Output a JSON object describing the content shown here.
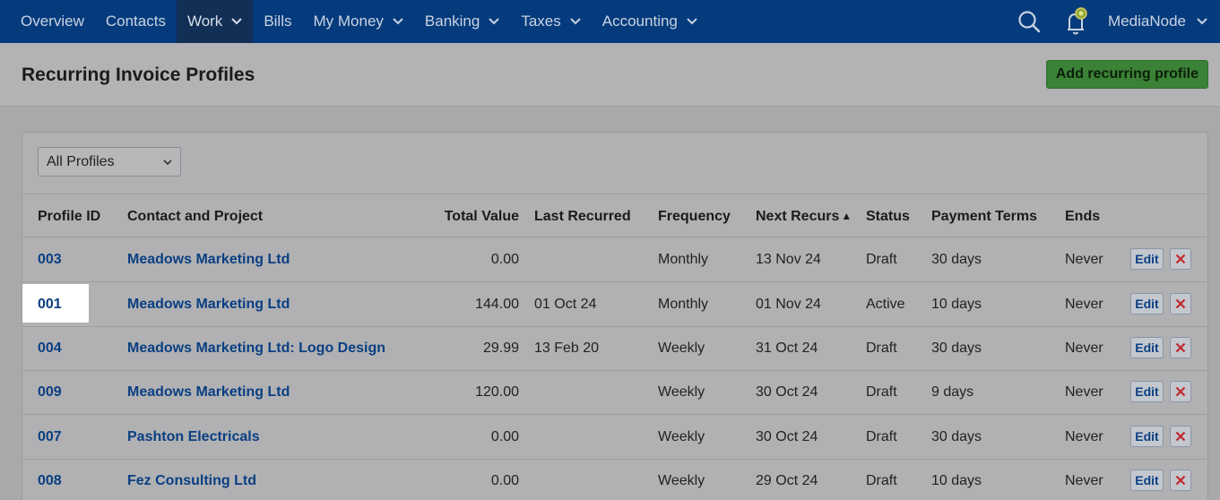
{
  "nav": {
    "items": [
      {
        "label": "Overview",
        "has_menu": false
      },
      {
        "label": "Contacts",
        "has_menu": false
      },
      {
        "label": "Work",
        "has_menu": true,
        "active": true
      },
      {
        "label": "Bills",
        "has_menu": false
      },
      {
        "label": "My Money",
        "has_menu": true
      },
      {
        "label": "Banking",
        "has_menu": true
      },
      {
        "label": "Taxes",
        "has_menu": true
      },
      {
        "label": "Accounting",
        "has_menu": true
      }
    ],
    "user": "MediaNode"
  },
  "header": {
    "title": "Recurring Invoice Profiles",
    "add_button": "Add recurring profile"
  },
  "filter": {
    "selected": "All Profiles"
  },
  "table": {
    "columns": {
      "id": "Profile ID",
      "contact": "Contact and Project",
      "total": "Total Value",
      "last": "Last Recurred",
      "freq": "Frequency",
      "next": "Next Recurs",
      "status": "Status",
      "terms": "Payment Terms",
      "ends": "Ends"
    },
    "sort_indicator": "▲",
    "rows": [
      {
        "id": "003",
        "contact": "Meadows Marketing Ltd",
        "total": "0.00",
        "last": "",
        "freq": "Monthly",
        "next": "13 Nov 24",
        "status": "Draft",
        "terms": "30 days",
        "ends": "Never",
        "edit": "Edit"
      },
      {
        "id": "001",
        "contact": "Meadows Marketing Ltd",
        "total": "144.00",
        "last": "01 Oct 24",
        "freq": "Monthly",
        "next": "01 Nov 24",
        "status": "Active",
        "terms": "10 days",
        "ends": "Never",
        "edit": "Edit"
      },
      {
        "id": "004",
        "contact": "Meadows Marketing Ltd: Logo Design",
        "total": "29.99",
        "last": "13 Feb 20",
        "freq": "Weekly",
        "next": "31 Oct 24",
        "status": "Draft",
        "terms": "30 days",
        "ends": "Never",
        "edit": "Edit"
      },
      {
        "id": "009",
        "contact": "Meadows Marketing Ltd",
        "total": "120.00",
        "last": "",
        "freq": "Weekly",
        "next": "30 Oct 24",
        "status": "Draft",
        "terms": "9 days",
        "ends": "Never",
        "edit": "Edit"
      },
      {
        "id": "007",
        "contact": "Pashton Electricals",
        "total": "0.00",
        "last": "",
        "freq": "Weekly",
        "next": "30 Oct 24",
        "status": "Draft",
        "terms": "30 days",
        "ends": "Never",
        "edit": "Edit"
      },
      {
        "id": "008",
        "contact": "Fez Consulting Ltd",
        "total": "0.00",
        "last": "",
        "freq": "Weekly",
        "next": "29 Oct 24",
        "status": "Draft",
        "terms": "10 days",
        "ends": "Never",
        "edit": "Edit"
      }
    ]
  },
  "colors": {
    "nav_bg": "#053b7c",
    "accent_green": "#3b8236",
    "link": "#0a3f82",
    "delete_red": "#c0282d"
  }
}
